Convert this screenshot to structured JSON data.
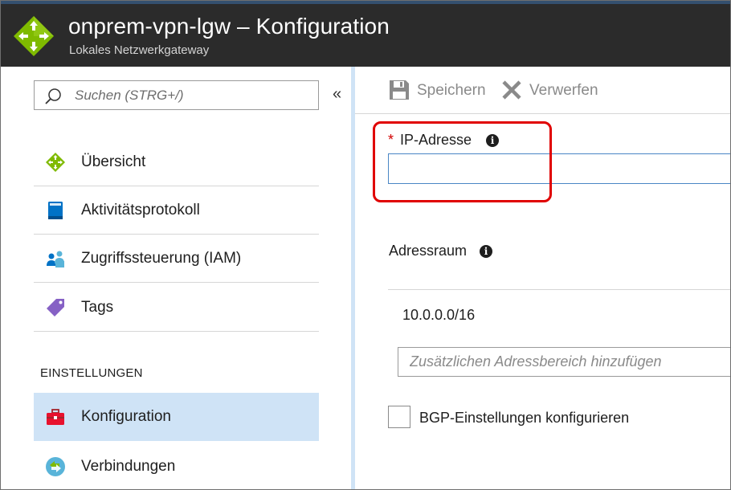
{
  "header": {
    "title": "onprem-vpn-lgw – Konfiguration",
    "subtitle": "Lokales Netzwerkgateway",
    "logo_icon": "local-network-gateway-icon"
  },
  "sidebar": {
    "search": {
      "placeholder": "Suchen (STRG+/)",
      "value": ""
    },
    "collapse_glyph": "«",
    "items": [
      {
        "label": "Übersicht",
        "icon": "overview-gateway-icon"
      },
      {
        "label": "Aktivitätsprotokoll",
        "icon": "activity-log-icon"
      },
      {
        "label": "Zugriffssteuerung (IAM)",
        "icon": "access-control-icon"
      },
      {
        "label": "Tags",
        "icon": "tag-icon"
      }
    ],
    "section_header": "EINSTELLUNGEN",
    "settings_items": [
      {
        "label": "Konfiguration",
        "icon": "configuration-toolbox-icon",
        "active": true
      },
      {
        "label": "Verbindungen",
        "icon": "connections-icon"
      }
    ]
  },
  "toolbar": {
    "save_label": "Speichern",
    "discard_label": "Verwerfen"
  },
  "form": {
    "ip_label": "IP-Adresse",
    "ip_required_mark": "*",
    "ip_value": "",
    "address_space_label": "Adressraum",
    "address_space_values": [
      "10.0.0.0/16"
    ],
    "address_add_placeholder": "Zusätzlichen Adressbereich hinzufügen",
    "bgp_label": "BGP-Einstellungen konfigurieren",
    "bgp_checked": false
  },
  "colors": {
    "header_bg": "#2b2b2b",
    "active_item_bg": "#cfe3f6",
    "highlight_red": "#e00000",
    "required_red": "#d20000",
    "input_focus_blue": "#4a86c5",
    "gateway_green": "#7fba00"
  }
}
